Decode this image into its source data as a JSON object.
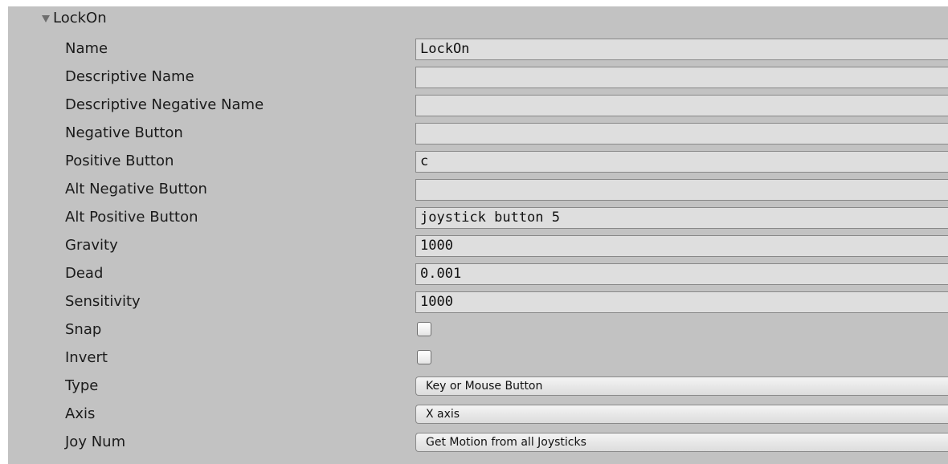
{
  "section": {
    "title": "LockOn"
  },
  "rows": {
    "name": {
      "label": "Name",
      "value": "LockOn"
    },
    "descriptive_name": {
      "label": "Descriptive Name",
      "value": ""
    },
    "descriptive_negative_name": {
      "label": "Descriptive Negative Name",
      "value": ""
    },
    "negative_button": {
      "label": "Negative Button",
      "value": ""
    },
    "positive_button": {
      "label": "Positive Button",
      "value": "c"
    },
    "alt_negative_button": {
      "label": "Alt Negative Button",
      "value": ""
    },
    "alt_positive_button": {
      "label": "Alt Positive Button",
      "value": "joystick button 5"
    },
    "gravity": {
      "label": "Gravity",
      "value": "1000"
    },
    "dead": {
      "label": "Dead",
      "value": "0.001"
    },
    "sensitivity": {
      "label": "Sensitivity",
      "value": "1000"
    },
    "snap": {
      "label": "Snap",
      "checked": false
    },
    "invert": {
      "label": "Invert",
      "checked": false
    },
    "type": {
      "label": "Type",
      "value": "Key or Mouse Button"
    },
    "axis": {
      "label": "Axis",
      "value": "X axis"
    },
    "joy_num": {
      "label": "Joy Num",
      "value": "Get Motion from all Joysticks"
    }
  },
  "icons": {
    "foldout": "triangle-down-icon"
  },
  "colors": {
    "panel_background": "#c2c2c2",
    "field_background": "#dedede",
    "text": "#1b1b1b"
  }
}
